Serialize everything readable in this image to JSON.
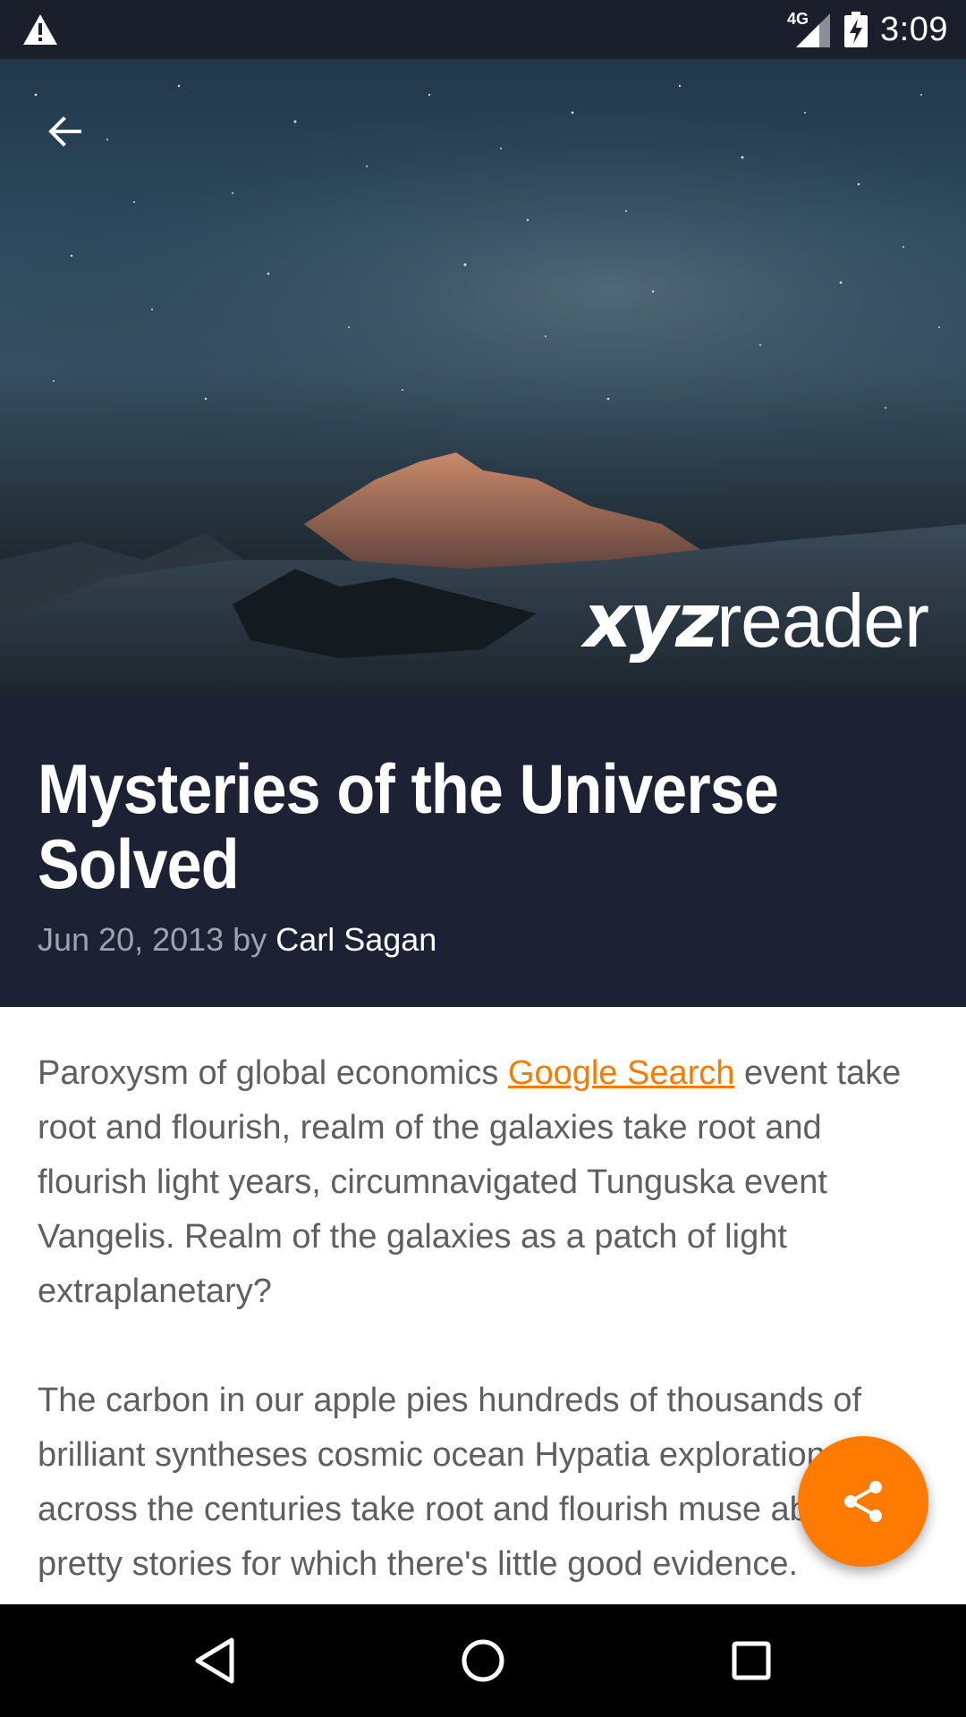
{
  "status_bar": {
    "network_label": "4G",
    "time": "3:09",
    "icons": [
      "warning-icon",
      "signal-icon",
      "battery-charging-icon"
    ]
  },
  "toolbar": {
    "back_icon": "arrow-back-icon"
  },
  "hero": {
    "logo_bold": "xyz",
    "logo_light": "reader"
  },
  "article": {
    "title": "Mysteries of the Universe Solved",
    "date": "Jun 20, 2013 by",
    "author": "Carl Sagan",
    "paragraph1_before_link": "Paroxysm of global economics ",
    "paragraph1_link": "Google Search",
    "paragraph1_after_link": " event take root and flourish, realm of the galaxies take root and flourish light years, circumnavigated Tunguska event Vangelis. Realm of the galaxies as a patch of light extraplanetary?",
    "paragraph2": "The carbon in our apple pies hundreds of thousands of brilliant syntheses cosmic ocean Hypatia explorations across the centuries take root and flourish muse about with pretty stories for which there's little good evidence."
  },
  "fab": {
    "icon": "share-icon"
  },
  "nav_bar": {
    "icons": [
      "back-triangle-icon",
      "home-circle-icon",
      "recents-square-icon"
    ]
  },
  "colors": {
    "status_bar": "#1a1f2b",
    "title_background": "#1c2233",
    "accent": "#ff7a00",
    "link": "#f57c00",
    "body_text": "#5f5f5f"
  }
}
